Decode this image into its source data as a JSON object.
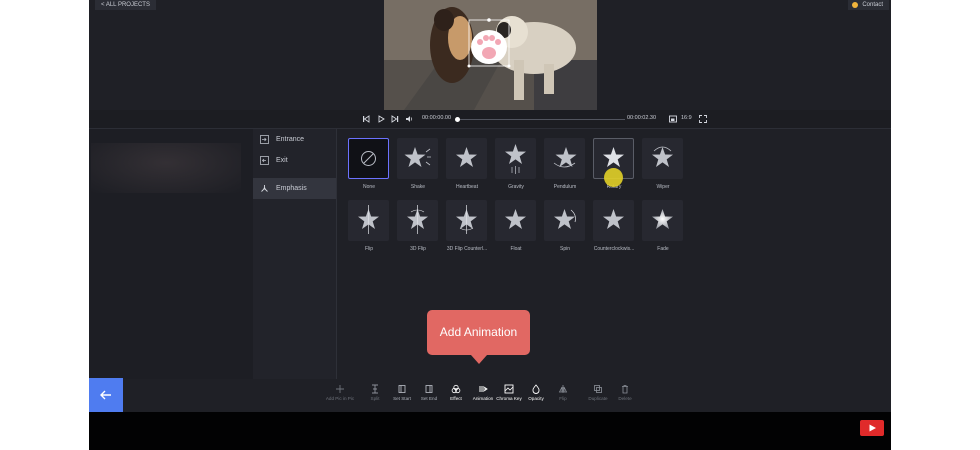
{
  "header": {
    "back_label": "< ALL PROJECTS",
    "contact_label": "Contact"
  },
  "player": {
    "current_time": "00:00:00.00",
    "total_time": "00:00:02.30",
    "aspect_ratio": "16:9",
    "progress": 0.0
  },
  "categories": [
    {
      "label": "Entrance",
      "icon": "entrance-icon"
    },
    {
      "label": "Exit",
      "icon": "exit-icon"
    },
    {
      "label": "Emphasis",
      "icon": "emphasis-icon",
      "active": true
    }
  ],
  "animations_row1": [
    {
      "label": "None",
      "icon": "none-icon",
      "selected": true
    },
    {
      "label": "Shake",
      "icon": "star-shake-icon"
    },
    {
      "label": "Heartbeat",
      "icon": "star-heartbeat-icon"
    },
    {
      "label": "Gravity",
      "icon": "star-gravity-icon"
    },
    {
      "label": "Pendulum",
      "icon": "star-pendulum-icon"
    },
    {
      "label": "Rotary",
      "icon": "star-rotary-icon",
      "hovered": true
    },
    {
      "label": "Wiper",
      "icon": "star-wiper-icon"
    }
  ],
  "animations_row2": [
    {
      "label": "Flip",
      "icon": "star-flip-icon"
    },
    {
      "label": "3D Flip",
      "icon": "star-3d-flip-icon"
    },
    {
      "label": "3D Flip Counterl...",
      "icon": "star-3d-flip-counter-icon"
    },
    {
      "label": "Float",
      "icon": "star-float-icon"
    },
    {
      "label": "Spin",
      "icon": "star-spin-icon"
    },
    {
      "label": "Counterclockwis...",
      "icon": "star-counterclockwise-icon"
    },
    {
      "label": "Fade",
      "icon": "star-fade-icon"
    }
  ],
  "tooltip": {
    "text": "Add Animation"
  },
  "toolbar": [
    {
      "label": "Add Pic in Pic",
      "icon": "add-pip-icon",
      "state": "dim"
    },
    {
      "label": "Split",
      "icon": "split-icon",
      "state": "dim"
    },
    {
      "label": "Set Start",
      "icon": "set-start-icon",
      "state": "normal"
    },
    {
      "label": "Set End",
      "icon": "set-end-icon",
      "state": "normal"
    },
    {
      "label": "Effect",
      "icon": "effect-icon",
      "state": "on"
    },
    {
      "label": "Animation",
      "icon": "animation-icon",
      "state": "on"
    },
    {
      "label": "Chroma Key",
      "icon": "chroma-key-icon",
      "state": "on"
    },
    {
      "label": "Opacity",
      "icon": "opacity-icon",
      "state": "on"
    },
    {
      "label": "Flip",
      "icon": "flip-icon",
      "state": "dim"
    },
    {
      "label": "Duplicate",
      "icon": "duplicate-icon",
      "state": "dim"
    },
    {
      "label": "Delete",
      "icon": "delete-icon",
      "state": "dim"
    }
  ],
  "colors": {
    "accent": "#4f7cf0",
    "tooltip": "#e16863",
    "selected_border": "#6c72ff",
    "panel": "#1f2026"
  }
}
